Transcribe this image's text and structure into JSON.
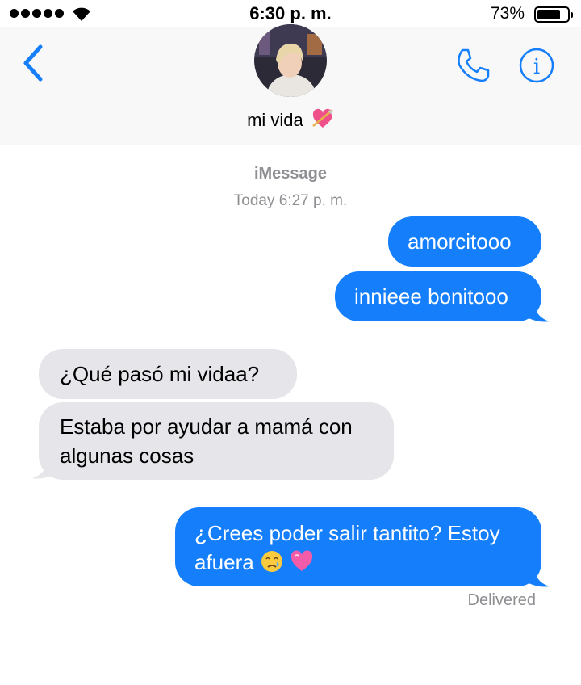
{
  "status_bar": {
    "time": "6:30 p. m.",
    "battery": "73%"
  },
  "header": {
    "contact_name": "mi vida"
  },
  "conversation": {
    "service": "iMessage",
    "timestamp": "Today 6:27 p. m.",
    "messages": [
      {
        "from": "me",
        "text": "amorcitooo"
      },
      {
        "from": "me",
        "text": "innieee bonitooo"
      },
      {
        "from": "them",
        "text": "¿Qué pasó mi vidaa?"
      },
      {
        "from": "them",
        "text": "Estaba por ayudar a mamá con algunas cosas"
      },
      {
        "from": "me",
        "text": "¿Crees poder salir tantito? Estoy afuera"
      }
    ],
    "delivery_status": "Delivered"
  },
  "colors": {
    "accent": "#147efb",
    "incoming": "#e5e5ea",
    "meta": "#8e8e93"
  },
  "icons": [
    "signal-dots",
    "wifi",
    "battery",
    "back-chevron",
    "phone",
    "info",
    "heart-arrow-emoji",
    "crying-emoji",
    "pink-heart-emoji"
  ]
}
